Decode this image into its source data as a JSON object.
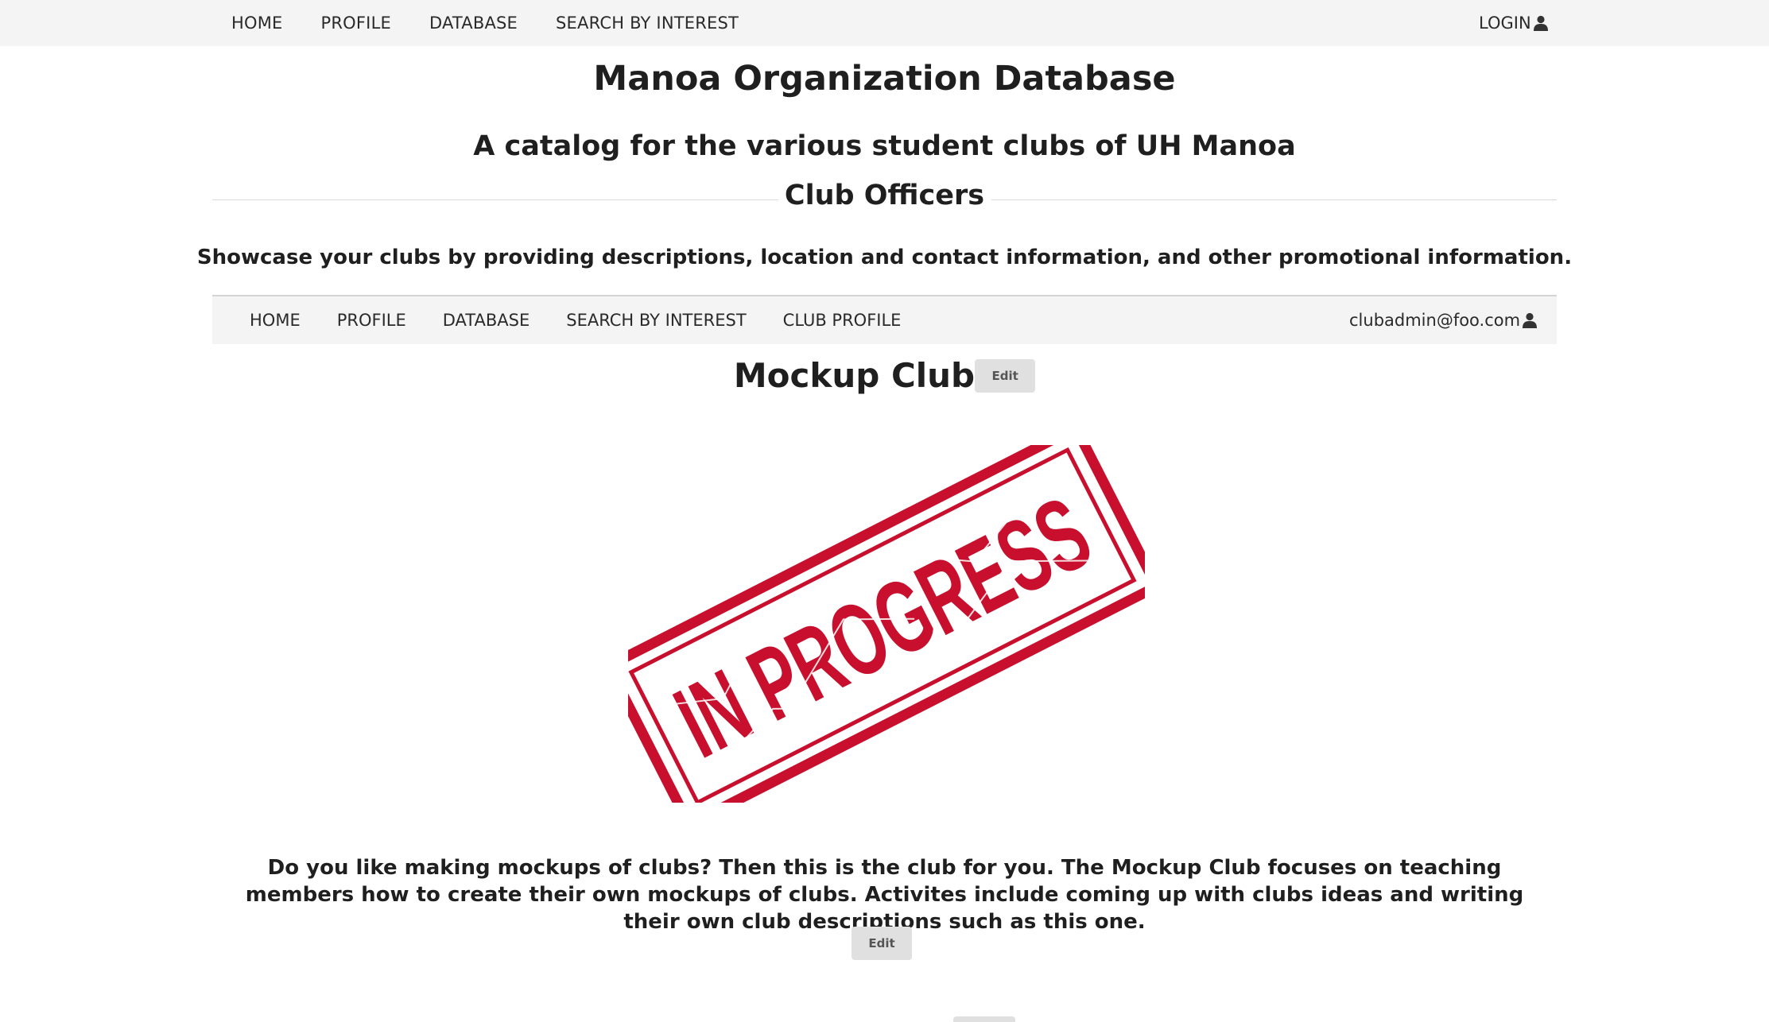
{
  "top_nav": {
    "items": [
      "HOME",
      "PROFILE",
      "DATABASE",
      "SEARCH BY INTEREST"
    ],
    "login_label": "LOGIN",
    "login_icon": "user-icon"
  },
  "header": {
    "title": "Manoa Organization Database",
    "subtitle": "A catalog for the various student clubs of UH Manoa"
  },
  "officers_section": {
    "heading": "Club Officers",
    "description": "Showcase your clubs by providing descriptions, location and contact information, and other promotional information."
  },
  "inner_nav": {
    "items": [
      "HOME",
      "PROFILE",
      "DATABASE",
      "SEARCH BY INTEREST",
      "CLUB PROFILE"
    ],
    "user_email": "clubadmin@foo.com",
    "user_icon": "user-icon"
  },
  "club": {
    "name": "Mockup Club",
    "edit_label": "Edit",
    "stamp_text": "IN PROGRESS",
    "stamp_color": "#c8102e",
    "description": "Do you like making mockups of clubs? Then this is the club for you. The Mockup Club focuses on teaching members how to create their own mockups of clubs. Activites include coming up with clubs ideas and writing their own club descriptions such as this one.",
    "description_edit_label": "Edit"
  }
}
